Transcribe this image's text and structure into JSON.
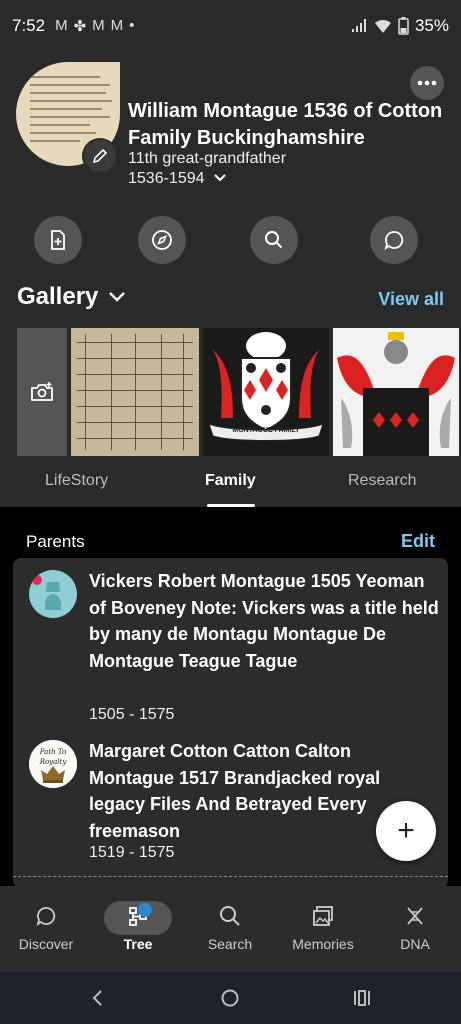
{
  "status_bar": {
    "time": "7:52",
    "notification_icons": [
      "gmail-icon",
      "pinwheel-icon",
      "gmail-icon",
      "gmail-icon",
      "dot-icon"
    ],
    "battery": "35%"
  },
  "profile": {
    "name": "William Montague 1536 of Cotton Family Buckinghamshire",
    "relation": "11th great-grandfather",
    "dates": "1536-1594"
  },
  "quick_actions": [
    "add-record-icon",
    "compass-icon",
    "search-icon",
    "comment-icon"
  ],
  "gallery": {
    "title": "Gallery",
    "view_all": "View all",
    "coat_label": "MONTAGUE FAMILY"
  },
  "tabs": [
    {
      "label": "LifeStory",
      "active": false
    },
    {
      "label": "Family",
      "active": true
    },
    {
      "label": "Research",
      "active": false
    }
  ],
  "parents": {
    "header": "Parents",
    "edit": "Edit",
    "people": [
      {
        "name": "Vickers Robert Montague 1505 Yeoman of Boveney Note: Vickers was a title held by many de Montagu Montague De Montague Teague Tague",
        "dates": "1505 - 1575"
      },
      {
        "name": "Margaret Cotton Catton Calton Montague 1517 Brandjacked royal legacy Files And Betrayed Every freemason",
        "dates": "1519 - 1575",
        "avatar_text_1": "Path To",
        "avatar_text_2": "Royalty"
      }
    ]
  },
  "fab": "+",
  "bottom_nav": [
    {
      "label": "Discover",
      "icon": "discover-icon"
    },
    {
      "label": "Tree",
      "icon": "tree-icon",
      "active": true
    },
    {
      "label": "Search",
      "icon": "search-icon"
    },
    {
      "label": "Memories",
      "icon": "memories-icon"
    },
    {
      "label": "DNA",
      "icon": "dna-icon"
    }
  ],
  "colors": {
    "accent": "#7ec8f2",
    "header_bg": "#2a2a2a",
    "card_bg": "#2c2c2c",
    "badge": "#2b8bd0"
  }
}
